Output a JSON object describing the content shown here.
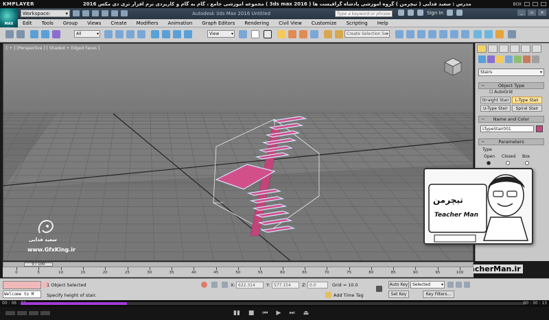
{
  "kmplayer": {
    "logo": "KMPLAYER",
    "title": "مجموعه آموزشی جامع ، گام به گام و کاربردی نرم افزار تری دی مکس 2016 ( 3ds max 2016 ) مدرس : سعید فدایی ( تیچرمن ) گروه آموزشی پادشاه گرافیست ها",
    "right_label": "BOX",
    "time_current": "00 : 06 : 33",
    "time_total": "00 : 30 : 13",
    "progress": 0.21
  },
  "max": {
    "logo_label": "MAX",
    "workspace": "Workspace: Default",
    "app_title": "Autodesk 3ds Max 2016    Untitled",
    "search_placeholder": "Type a keyword or phrase",
    "sign_in": "Sign In",
    "menu": [
      "Edit",
      "Tools",
      "Group",
      "Views",
      "Create",
      "Modifiers",
      "Animation",
      "Graph Editors",
      "Rendering",
      "Civil View",
      "Customize",
      "Scripting",
      "Help"
    ],
    "toolbar": {
      "filter": "All",
      "ref_coord": "View",
      "selection_set": "Create Selection Se"
    }
  },
  "viewport": {
    "label": "[ + ] [Perspective ] [ Shaded + Edged Faces ]"
  },
  "command_panel": {
    "category": "Stairs",
    "object_type_title": "Object Type",
    "autogrid": "AutoGrid",
    "buttons": [
      "Straight Stair",
      "L-Type Stair",
      "U-Type Stair",
      "Spiral Stair"
    ],
    "name_color_title": "Name and Color",
    "object_name": "LTypeStair001",
    "parameters_title": "Parameters",
    "type_label": "Type",
    "type_options": [
      "Open",
      "Closed",
      "Box"
    ]
  },
  "overlay": {
    "brand_fa": "تیچرمن",
    "brand_en": "Teacher Man",
    "url": "www.TeacherMan.ir",
    "watermark_name": "سعید فدایی",
    "watermark_url": "www.GfxKing.ir"
  },
  "timeline": {
    "frame_display": "0 / 100",
    "ticks": [
      0,
      5,
      10,
      15,
      20,
      25,
      30,
      35,
      40,
      45,
      50,
      55,
      60,
      65,
      70,
      75,
      80,
      85,
      90,
      95,
      100
    ]
  },
  "status": {
    "maxscript_text": "Welcome to M",
    "selected": "1 Object Selected",
    "prompt": "Specify height of stair.",
    "x_label": "X:",
    "x_value": "622.314",
    "y_label": "Y:",
    "y_value": "577.154",
    "z_label": "Z:",
    "z_value": "0.0",
    "grid": "Grid = 10.0",
    "add_time_tag": "Add Time Tag",
    "auto_key": "Auto Key",
    "selected_drop": "Selected",
    "set_key": "Set Key",
    "key_filters": "Key Filters..."
  }
}
